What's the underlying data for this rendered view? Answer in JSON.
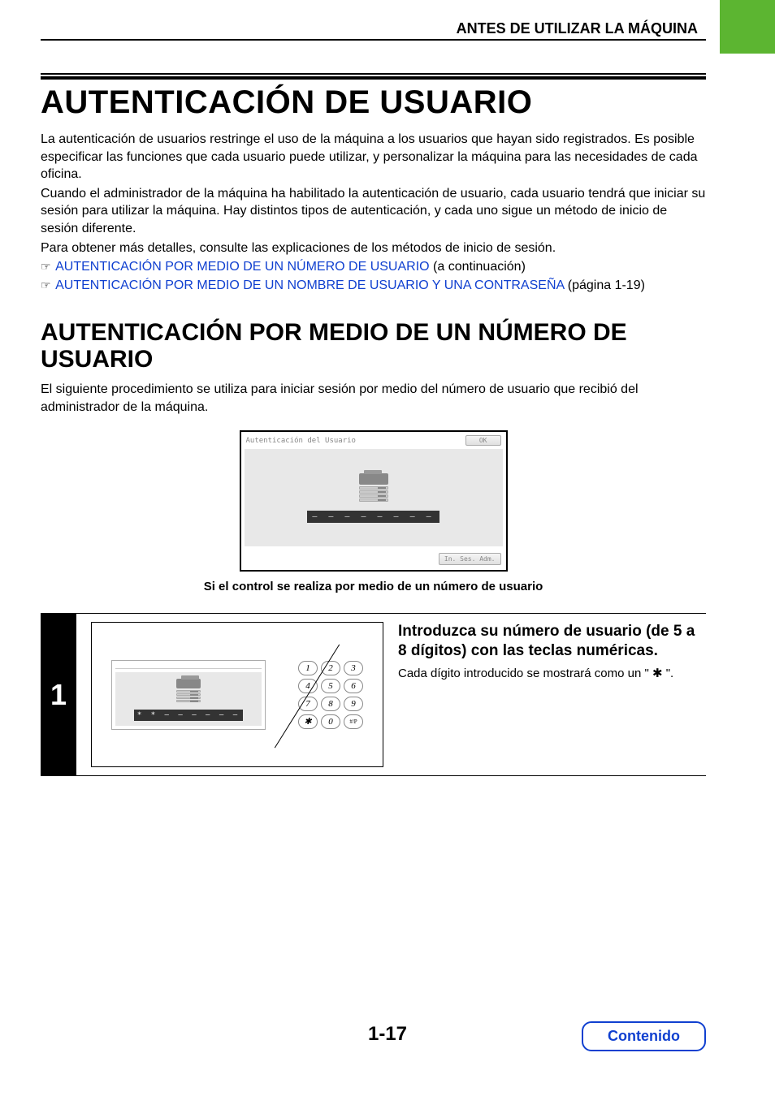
{
  "header": {
    "section": "ANTES DE UTILIZAR LA MÁQUINA"
  },
  "title": "AUTENTICACIÓN DE USUARIO",
  "intro": {
    "p1": "La autenticación de usuarios restringe el uso de la máquina a los usuarios que hayan sido registrados. Es posible especificar las funciones que cada usuario puede utilizar, y personalizar la máquina para las necesidades de cada oficina.",
    "p2": "Cuando el administrador de la máquina ha habilitado la autenticación de usuario, cada usuario tendrá que iniciar su sesión para utilizar la máquina. Hay distintos tipos de autenticación, y cada uno sigue un método de inicio de sesión diferente.",
    "p3": "Para obtener más detalles, consulte las explicaciones de los métodos de inicio de sesión."
  },
  "refs": {
    "r1_link": "AUTENTICACIÓN POR MEDIO DE UN NÚMERO DE USUARIO",
    "r1_suffix": " (a continuación)",
    "r2_link": "AUTENTICACIÓN POR MEDIO DE UN NOMBRE DE USUARIO Y UNA CONTRASEÑA",
    "r2_suffix": " (página 1-19)"
  },
  "subtitle": "AUTENTICACIÓN POR MEDIO DE UN NÚMERO DE USUARIO",
  "sub_intro": "El siguiente procedimiento se utiliza para iniciar sesión por medio del número de usuario que recibió del administrador de la máquina.",
  "panel": {
    "title": "Autenticación del Usuario",
    "ok": "OK",
    "digits": "— — — — — — — —",
    "admin": "In. Ses. Adm."
  },
  "caption": "Si el control se realiza por medio de un número de usuario",
  "step": {
    "num": "1",
    "mini_digits": "* * — — — — — —",
    "keys": [
      "1",
      "2",
      "3",
      "4",
      "5",
      "6",
      "7",
      "8",
      "9",
      "✱",
      "0",
      "#/P"
    ],
    "heading": "Introduzca su número de usuario (de 5 a 8 dígitos) con las teclas numéricas.",
    "body": "Cada dígito introducido se mostrará como un \" ✱ \"."
  },
  "page_number": "1-17",
  "contents_button": "Contenido"
}
